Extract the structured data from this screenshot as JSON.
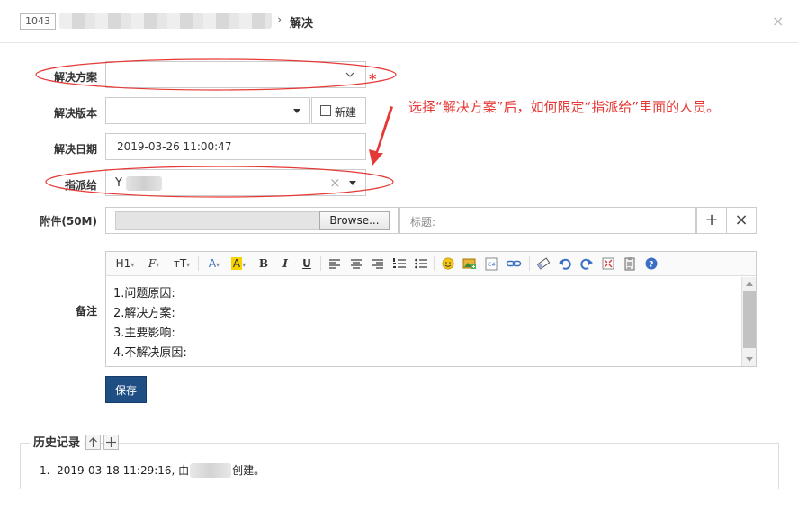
{
  "header": {
    "id_badge": "1043",
    "separator": "›",
    "title": "解决",
    "close_glyph": "×"
  },
  "form": {
    "resolution_label": "解决方案",
    "resolution_value": "",
    "required_mark": "*",
    "build_label": "解决版本",
    "build_value": "",
    "new_label": "新建",
    "date_label": "解决日期",
    "date_value": "2019-03-26 11:00:47",
    "assign_label": "指派给",
    "assign_value": "Y",
    "assign_clear_glyph": "×",
    "attachment_label": "附件(50M)",
    "browse_label": "Browse...",
    "caption_placeholder": "标题:",
    "add_glyph": "+",
    "remove_glyph": "×",
    "remark_label": "备注"
  },
  "editor": {
    "toolbar": {
      "heading": "H1",
      "font": "𝓕",
      "font_size": "тT",
      "font_color": "A",
      "bg_color": "A",
      "bold": "B",
      "italic": "I",
      "underline": "U"
    },
    "lines": [
      "1.问题原因:",
      "2.解决方案:",
      "3.主要影响:",
      "4.不解决原因:"
    ]
  },
  "save_label": "保存",
  "history": {
    "title": "历史记录",
    "items": [
      {
        "num": "1.",
        "prefix": "2019-03-18 11:29:16, 由",
        "suffix": "创建。"
      }
    ]
  },
  "annotation": {
    "note": "选择“解决方案”后，如何限定“指派给”里面的人员。",
    "color": "#e53935"
  },
  "colors": {
    "primary_button": "#1f4e85",
    "annotation": "#e53935"
  }
}
